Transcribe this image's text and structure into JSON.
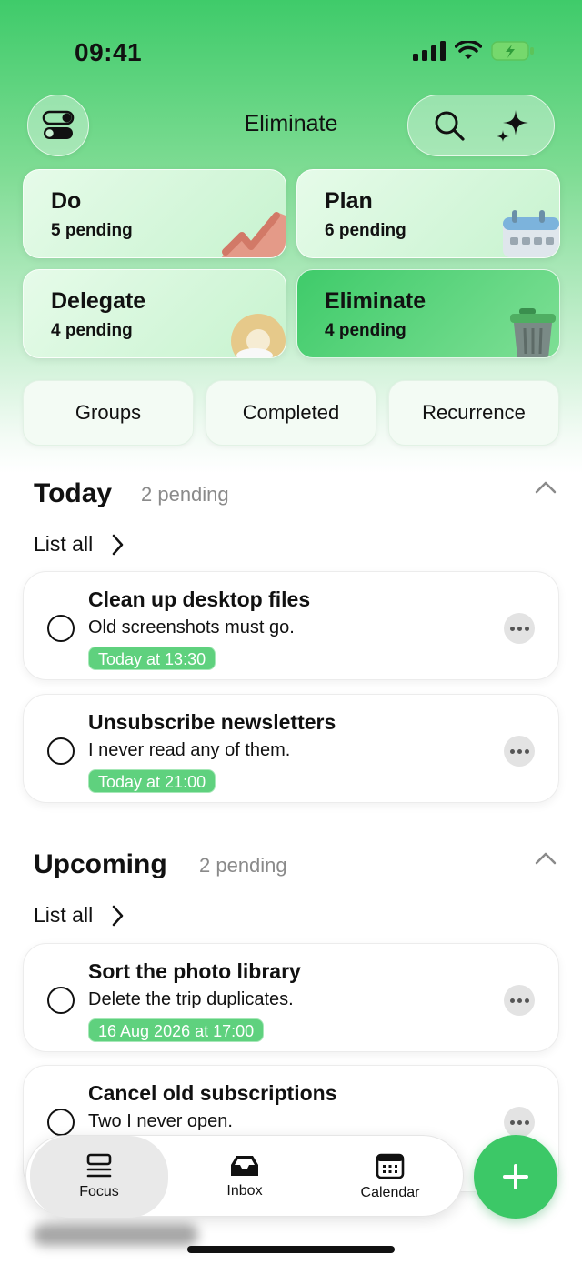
{
  "status_bar": {
    "time": "09:41"
  },
  "header": {
    "title": "Eliminate"
  },
  "quadrants": [
    {
      "title": "Do",
      "pending": "5 pending"
    },
    {
      "title": "Plan",
      "pending": "6 pending"
    },
    {
      "title": "Delegate",
      "pending": "4 pending"
    },
    {
      "title": "Eliminate",
      "pending": "4 pending"
    }
  ],
  "filters": [
    "Groups",
    "Completed",
    "Recurrence"
  ],
  "sections": [
    {
      "title": "Today",
      "count": "2 pending",
      "list_all": "List all",
      "tasks": [
        {
          "title": "Clean up desktop files",
          "note": "Old screenshots must go.",
          "when": "Today at 13:30"
        },
        {
          "title": "Unsubscribe newsletters",
          "note": "I never read any of them.",
          "when": "Today at 21:00"
        }
      ]
    },
    {
      "title": "Upcoming",
      "count": "2 pending",
      "list_all": "List all",
      "tasks": [
        {
          "title": "Sort the photo library",
          "note": "Delete the trip duplicates.",
          "when": "16 Aug 2026 at 17:00"
        },
        {
          "title": "Cancel old subscriptions",
          "note": "Two I never open.",
          "when": ""
        }
      ]
    }
  ],
  "nav": {
    "items": [
      "Focus",
      "Inbox",
      "Calendar"
    ],
    "active": "Focus"
  },
  "colors": {
    "accent": "#3cc867",
    "badge": "#5fd17e"
  }
}
